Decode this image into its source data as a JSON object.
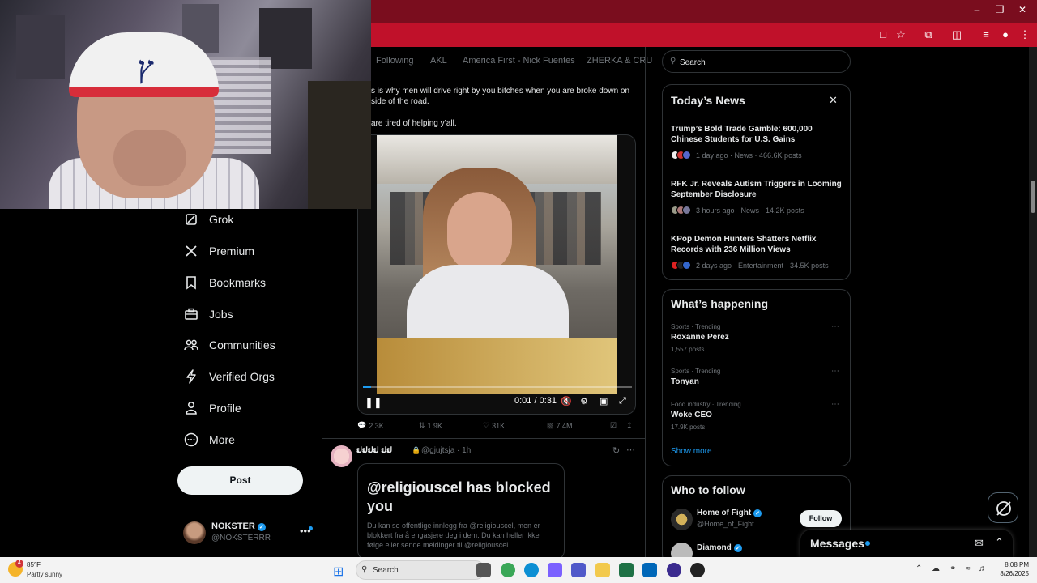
{
  "tabs": [
    "Following",
    "AKL",
    "America First - Nick Fuentes",
    "ZHERKA & CRU"
  ],
  "nav": {
    "items": [
      {
        "label": "Grok",
        "icon": "grok-icon"
      },
      {
        "label": "Premium",
        "icon": "x-logo-icon"
      },
      {
        "label": "Bookmarks",
        "icon": "bookmark-icon"
      },
      {
        "label": "Jobs",
        "icon": "briefcase-icon"
      },
      {
        "label": "Communities",
        "icon": "people-icon"
      },
      {
        "label": "Verified Orgs",
        "icon": "lightning-icon"
      },
      {
        "label": "Profile",
        "icon": "person-icon"
      },
      {
        "label": "More",
        "icon": "more-circle-icon"
      }
    ],
    "post_label": "Post"
  },
  "account": {
    "name": "NOKSTER",
    "handle": "@NOKSTERRR",
    "more": "•••"
  },
  "post1": {
    "text_line1": "s is why men will drive right by you bitches when you are broke down on",
    "text_line2": "side of the road.",
    "text_line3": "are tired of helping y’all.",
    "video_time": "0:01 / 0:31",
    "video_progress": 0.03,
    "replies": "2.3K",
    "reposts": "1.9K",
    "likes": "31K",
    "views": "7.4M"
  },
  "post2": {
    "name": "ຢຢຢຢ ຢຢ",
    "handle": "@gjujtsja",
    "time": "1h",
    "quote_title": "@religiouscel has blocked you",
    "quote_body": "Du kan se offentlige innlegg fra @religiouscel, men er blokkert fra å engasjere deg i dem. Du kan heller ikke følge eller sende meldinger til @religiouscel."
  },
  "search": {
    "placeholder": "Search"
  },
  "news": {
    "title": "Today’s News",
    "items": [
      {
        "headline": "Trump’s Bold Trade Gamble: 600,000 Chinese Students for U.S. Gains",
        "meta": "1 day ago · News · 466.6K posts"
      },
      {
        "headline": "RFK Jr. Reveals Autism Triggers in Looming September Disclosure",
        "meta": "3 hours ago · News · 14.2K posts"
      },
      {
        "headline": "KPop Demon Hunters Shatters Netflix Records with 236 Million Views",
        "meta": "2 days ago · Entertainment · 34.5K posts"
      }
    ]
  },
  "happening": {
    "title": "What’s happening",
    "items": [
      {
        "category": "Sports · Trending",
        "topic": "Roxanne Perez",
        "posts": "1,557 posts"
      },
      {
        "category": "Sports · Trending",
        "topic": "Tonyan",
        "posts": ""
      },
      {
        "category": "Food industry · Trending",
        "topic": "Woke CEO",
        "posts": "17.9K posts"
      }
    ],
    "show_more": "Show more"
  },
  "who_to_follow": {
    "title": "Who to follow",
    "items": [
      {
        "name": "Home of Fight",
        "handle": "@Home_of_Fight"
      },
      {
        "name": "Diamond",
        "handle": ""
      }
    ],
    "follow_label": "Follow"
  },
  "messages": {
    "label": "Messages"
  },
  "taskbar": {
    "temp": "85°F",
    "weather": "Partly sunny",
    "search": "Search",
    "time": "8:08 PM",
    "date": "8/26/2025",
    "badge": "4"
  },
  "colors": {
    "accent": "#1d9bf0",
    "browser_red": "#c0112a",
    "browser_dark": "#7a0d1e"
  }
}
